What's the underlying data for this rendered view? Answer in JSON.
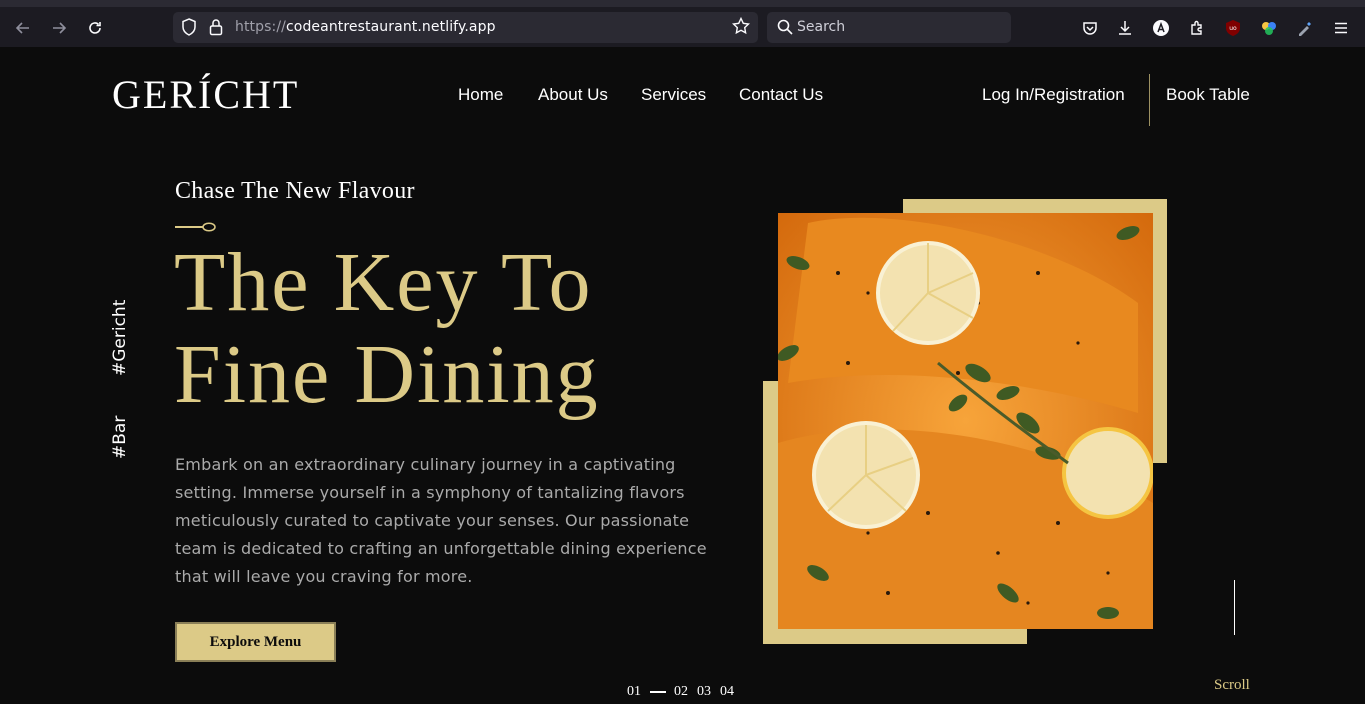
{
  "browser": {
    "url_prefix": "https://",
    "url_host": "codeantrestaurant.netlify.app",
    "search_placeholder": "Search"
  },
  "header": {
    "logo": "GERÍCHT",
    "nav": [
      "Home",
      "About Us",
      "Services",
      "Contact Us"
    ],
    "login": "Log In/Registration",
    "book": "Book Table"
  },
  "hero": {
    "subtitle": "Chase The New Flavour",
    "title_line1": "The Key To",
    "title_line2": "Fine Dining",
    "body": "Embark on an extraordinary culinary journey in a captivating setting. Immerse yourself in a symphony of tantalizing flavors meticulously curated to captivate your senses. Our passionate team is dedicated to crafting an unforgettable dining experience that will leave you craving for more.",
    "cta": "Explore Menu"
  },
  "side_tags": [
    "#Gericht",
    "#Bar"
  ],
  "pager": [
    "01",
    "02",
    "03",
    "04"
  ],
  "scroll_label": "Scroll",
  "colors": {
    "gold": "#dcca87",
    "background": "#0c0c0c",
    "body_text": "#aaaaaa"
  }
}
